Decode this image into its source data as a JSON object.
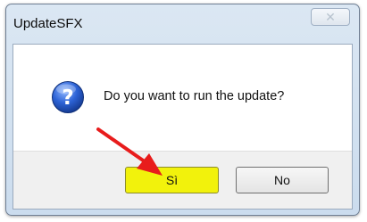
{
  "window": {
    "title": "UpdateSFX",
    "close_icon": "close-icon"
  },
  "message": {
    "icon": "question-icon",
    "icon_glyph": "?",
    "text": "Do you want to run the update?"
  },
  "buttons": {
    "yes_label": "Sì",
    "no_label": "No",
    "yes_highlight_color": "#f2f20c"
  },
  "annotation": {
    "arrow_color": "#e81c1c"
  }
}
